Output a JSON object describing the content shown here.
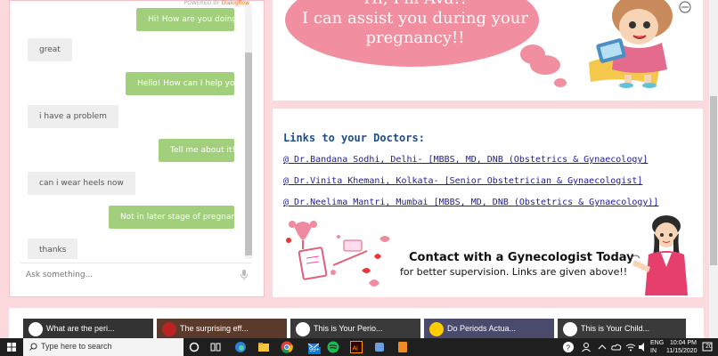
{
  "chat": {
    "powered_by": "POWERED BY",
    "powered_brand": "Dialogflow",
    "messages": [
      {
        "from": "bot",
        "text": "Hi! How are you doing?"
      },
      {
        "from": "user",
        "text": "great"
      },
      {
        "from": "bot",
        "text": "Hello! How can I help you?"
      },
      {
        "from": "user",
        "text": "i have a problem"
      },
      {
        "from": "bot",
        "text": "Tell me about it!"
      },
      {
        "from": "user",
        "text": "can i wear heels now"
      },
      {
        "from": "bot",
        "text": "Not in later stage of pregnancy!"
      },
      {
        "from": "user",
        "text": "thanks"
      }
    ],
    "input_placeholder": "Ask something..."
  },
  "hero": {
    "line1": "Hi, I'm Ava!!",
    "line2": "I can assist you during your",
    "line3": "pregnancy!!"
  },
  "doctors": {
    "title": "Links to your Doctors:",
    "links": [
      "@ Dr.Bandana Sodhi, Delhi- [MBBS, MD, DNB (Obstetrics & Gynaecology]",
      "@ Dr.Vinita Khemani, Kolkata- [Senior Obstetrician & Gynaecologist]",
      "@ Dr.Neelima Mantri, Mumbai [MBBS, MD, DNB (Obstetrics & Gynaecology)]"
    ],
    "contact_title": "Contact with a Gynecologist Today",
    "contact_sub": "for better supervision. Links are given above!!"
  },
  "videos": [
    {
      "title": "What are the peri..."
    },
    {
      "title": "The surprising eff..."
    },
    {
      "title": "This is Your Perio..."
    },
    {
      "title": "Do Periods Actua..."
    },
    {
      "title": "This is Your Child..."
    }
  ],
  "taskbar": {
    "search_placeholder": "Type here to search",
    "badge": "99+",
    "lang1": "ENG",
    "lang2": "IN",
    "time": "10:04 PM",
    "date": "11/15/2020",
    "notifications": "20"
  },
  "colors": {
    "page_bg": "#fbd9dc",
    "bot_bubble": "#a2cf7c",
    "user_bubble": "#eeeeee",
    "cloud": "#f18fa0",
    "link": "#1a1aa6"
  }
}
